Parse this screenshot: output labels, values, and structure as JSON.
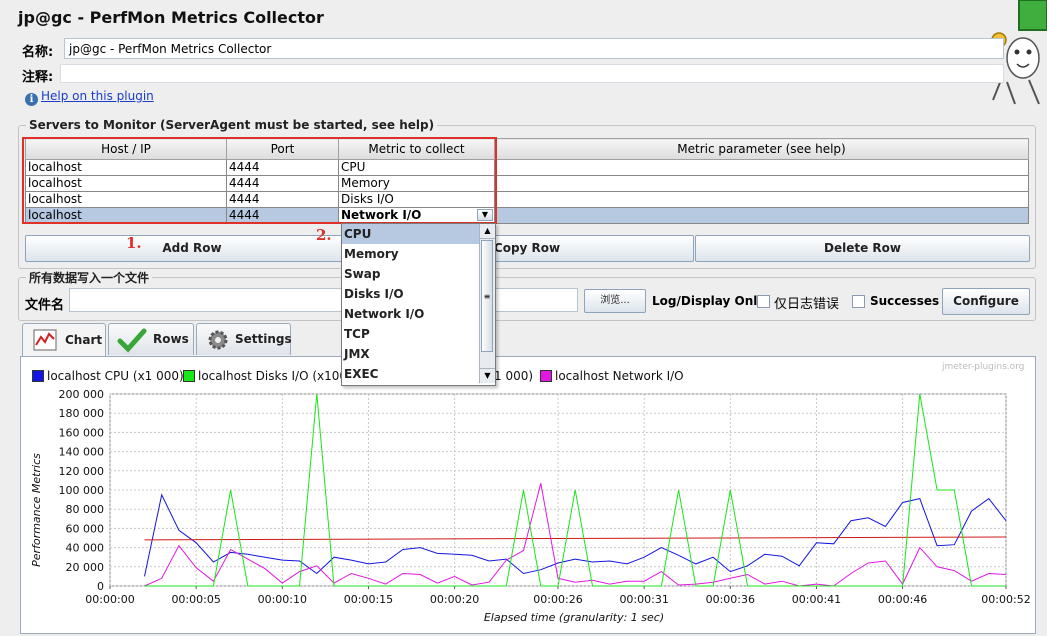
{
  "window": {
    "title": "jp@gc - PerfMon Metrics Collector"
  },
  "form": {
    "name_label": "名称:",
    "name_value": "jp@gc - PerfMon Metrics Collector",
    "comment_label": "注释:",
    "comment_value": "",
    "help_icon": "info-icon",
    "help_link": "Help on this plugin"
  },
  "servers": {
    "group_title": "Servers to Monitor (ServerAgent must be started, see help)",
    "columns": [
      "Host / IP",
      "Port",
      "Metric to collect",
      "Metric parameter (see help)"
    ],
    "rows": [
      {
        "host": "localhost",
        "port": "4444",
        "metric": "CPU",
        "param": ""
      },
      {
        "host": "localhost",
        "port": "4444",
        "metric": "Memory",
        "param": ""
      },
      {
        "host": "localhost",
        "port": "4444",
        "metric": "Disks I/O",
        "param": ""
      },
      {
        "host": "localhost",
        "port": "4444",
        "metric": "Network I/O",
        "param": ""
      }
    ],
    "selected_row": 3,
    "buttons": {
      "add": "Add Row",
      "copy": "Copy Row",
      "delete": "Delete Row"
    }
  },
  "metric_dropdown": {
    "options": [
      "CPU",
      "Memory",
      "Swap",
      "Disks I/O",
      "Network I/O",
      "TCP",
      "JMX",
      "EXEC"
    ],
    "highlighted": "CPU"
  },
  "annotations": {
    "first": "1.",
    "second": "2."
  },
  "file": {
    "group_title": "所有数据写入一个文件",
    "filename_label": "文件名",
    "filename_value": "",
    "browse": "浏览...",
    "log_display_label": "Log/Display Only:",
    "errors_only": "仅日志错误",
    "successes": "Successes",
    "configure": "Configure"
  },
  "tabs": [
    {
      "label": "Chart",
      "icon": "chart-icon",
      "active": true
    },
    {
      "label": "Rows",
      "icon": "checkmark-icon",
      "active": false
    },
    {
      "label": "Settings",
      "icon": "gear-icon",
      "active": false
    }
  ],
  "chart": {
    "watermark": "jmeter-plugins.org",
    "legend": [
      {
        "label": "localhost CPU (x1 000)",
        "color": "#1414e0"
      },
      {
        "label": "localhost Disks I/O (x100 0",
        "color": "#18e618"
      },
      {
        "label": "1 000)",
        "color": "#e018e0"
      },
      {
        "label": "localhost Network I/O",
        "color": "#e018e0"
      }
    ]
  },
  "chart_data": {
    "type": "line",
    "xlabel": "Elapsed time (granularity: 1 sec)",
    "ylabel": "Performance Metrics",
    "ylim": [
      0,
      200000
    ],
    "yticks": [
      "0",
      "20 000",
      "40 000",
      "60 000",
      "80 000",
      "100 000",
      "120 000",
      "140 000",
      "160 000",
      "180 000",
      "200 000"
    ],
    "xlim": [
      0,
      52
    ],
    "xtick_seconds": [
      0,
      5,
      10,
      15,
      20,
      26,
      31,
      36,
      41,
      46,
      52
    ],
    "xticks": [
      "00:00:00",
      "00:00:05",
      "00:00:10",
      "00:00:15",
      "00:00:20",
      "00:00:26",
      "00:00:31",
      "00:00:36",
      "00:00:41",
      "00:00:46",
      "00:00:52"
    ],
    "grid": true,
    "series": [
      {
        "name": "localhost CPU (x1 000)",
        "color": "#1414e0",
        "x": [
          2,
          3,
          4,
          5,
          6,
          7,
          8,
          9,
          10,
          11,
          12,
          13,
          14,
          15,
          16,
          17,
          18,
          19,
          20,
          21,
          22,
          23,
          24,
          25,
          26,
          27,
          28,
          29,
          30,
          31,
          32,
          33,
          34,
          35,
          36,
          37,
          38,
          39,
          40,
          41,
          42,
          43,
          44,
          45,
          46,
          47,
          48,
          49,
          50,
          51,
          52
        ],
        "y": [
          10000,
          95000,
          58000,
          45000,
          25000,
          35000,
          33000,
          30000,
          27000,
          26000,
          13000,
          30000,
          27000,
          23000,
          25000,
          38000,
          40000,
          34000,
          33000,
          32000,
          26000,
          28000,
          13000,
          17000,
          24000,
          28000,
          25000,
          26000,
          23000,
          30000,
          40000,
          32000,
          23000,
          30000,
          15000,
          21000,
          33000,
          31000,
          21000,
          45000,
          44000,
          68000,
          71000,
          62000,
          87000,
          91000,
          42000,
          43000,
          78000,
          91000,
          68000
        ]
      },
      {
        "name": "",
        "color": "#d01818",
        "x": [
          2,
          52
        ],
        "y": [
          48000,
          51000
        ]
      },
      {
        "name": "localhost Network I/O",
        "color": "#e018e0",
        "x": [
          2,
          3,
          4,
          5,
          6,
          7,
          8,
          9,
          10,
          11,
          12,
          13,
          14,
          15,
          16,
          17,
          18,
          19,
          20,
          21,
          22,
          23,
          24,
          25,
          26,
          27,
          28,
          29,
          30,
          31,
          32,
          33,
          34,
          35,
          36,
          37,
          38,
          39,
          40,
          41,
          42,
          43,
          44,
          45,
          46,
          47,
          48,
          49,
          50,
          51,
          52
        ],
        "y": [
          0,
          8000,
          42000,
          19000,
          5000,
          38000,
          28000,
          18000,
          3000,
          15000,
          21000,
          3000,
          13000,
          8000,
          2000,
          13000,
          12000,
          3000,
          10000,
          1000,
          4000,
          27000,
          37000,
          107000,
          8000,
          4000,
          6000,
          2000,
          5000,
          5000,
          15000,
          1000,
          2000,
          4000,
          8000,
          12000,
          2000,
          5000,
          0,
          2000,
          0,
          13000,
          24000,
          26000,
          2000,
          40000,
          20000,
          16000,
          5000,
          13000,
          12000
        ]
      },
      {
        "name": "",
        "color": "#18e618",
        "x": [
          2,
          3,
          4,
          5,
          6,
          7,
          8,
          9,
          10,
          11,
          12,
          13,
          14,
          15,
          16,
          17,
          18,
          19,
          20,
          21,
          22,
          23,
          24,
          25,
          26,
          27,
          28,
          29,
          30,
          31,
          32,
          33,
          34,
          35,
          36,
          37,
          38,
          39,
          40,
          41,
          42,
          43,
          44,
          45,
          46,
          47,
          48,
          49,
          50,
          51,
          52
        ],
        "y": [
          0,
          0,
          0,
          0,
          0,
          100000,
          0,
          0,
          0,
          0,
          200000,
          0,
          0,
          0,
          0,
          0,
          0,
          0,
          0,
          0,
          0,
          0,
          100000,
          0,
          0,
          100000,
          0,
          0,
          0,
          0,
          0,
          100000,
          0,
          0,
          100000,
          0,
          0,
          0,
          0,
          0,
          0,
          0,
          0,
          0,
          0,
          200000,
          100000,
          100000,
          0,
          0,
          0
        ]
      }
    ]
  }
}
